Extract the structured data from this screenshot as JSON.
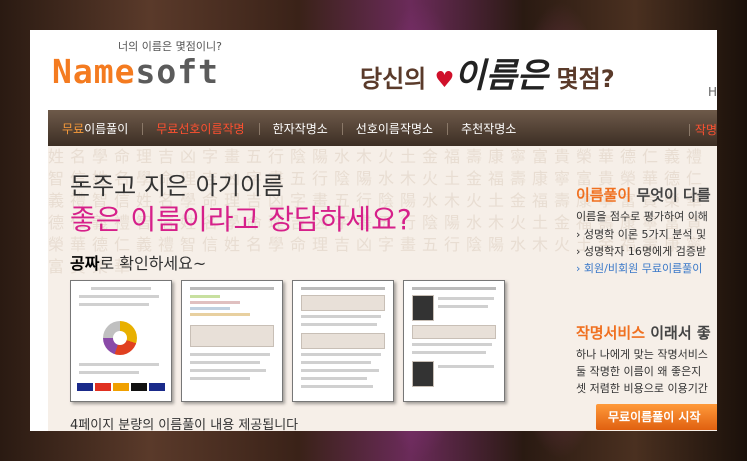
{
  "header": {
    "logo_part1": "Name",
    "logo_part2": "soft",
    "tagline": "너의 이름은 몇점이니?",
    "hero_pre": "당신의",
    "hero_heart": "♥",
    "hero_script": "이름은",
    "hero_post": "몇점?",
    "corner_link": "H"
  },
  "nav": {
    "items": [
      {
        "prefix": "무료",
        "rest": "이름풀이"
      },
      {
        "label": "무료선호이름작명"
      },
      {
        "label": "한자작명소"
      },
      {
        "label": "선호이름작명소"
      },
      {
        "label": "추천작명소"
      }
    ],
    "cut_item": "작명"
  },
  "main": {
    "headline1": "돈주고 지은 아기이름",
    "headline2": "좋은 이름이라고 장담하세요?",
    "free_bold": "공짜",
    "free_rest": "로 확인하세요~",
    "caption": "4페이지 분량의 이름풀이 내용 제공됩니다"
  },
  "side": {
    "title1_orange": "이름풀이",
    "title1_rest": " 무엇이 다를",
    "line1": "이름을 점수로 평가하여 이해",
    "line2": "› 성명학 이론 5가지 분석 및",
    "line3": "› 성명학자 16명에게 검증받",
    "line4": "› 회원/비회원 무료이름풀이",
    "title2_orange": "작명서비스",
    "title2_rest": " 이래서 좋",
    "line5": "하나 나에게 맞는 작명서비스",
    "line6": "둘 작명한 이름이 왜 좋은지",
    "line7": "셋 저렴한 비용으로 이용기간",
    "button": "무료이름풀이 시작"
  },
  "colors": {
    "accent_orange": "#f47b20",
    "pink_headline": "#d6208a",
    "nav_bg": "#4a3a2e"
  }
}
